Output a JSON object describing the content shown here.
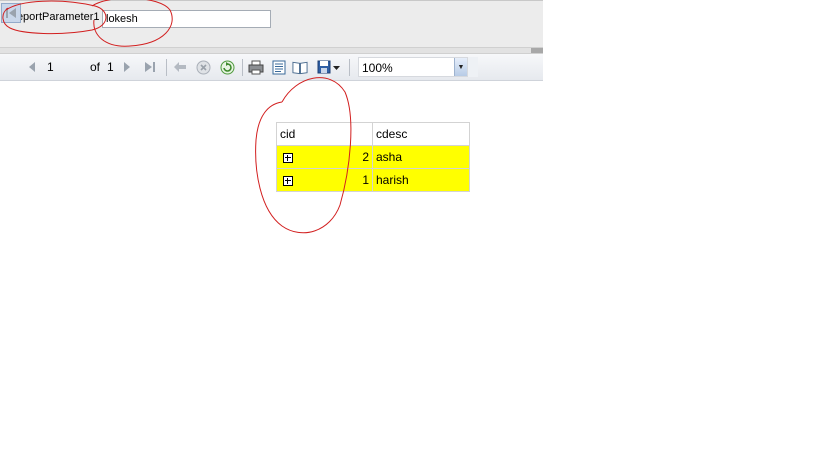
{
  "parameters": {
    "label": "ReportParameter1",
    "value": "lokesh"
  },
  "toolbar": {
    "page_current": "1",
    "page_of": "of",
    "page_total": "1",
    "zoom": "100%",
    "icons": [
      "first-page-icon",
      "prev-page-icon",
      "next-page-icon",
      "last-page-icon",
      "back-icon",
      "stop-icon",
      "refresh-icon",
      "print-icon",
      "print-layout-icon",
      "page-setup-icon",
      "export-icon"
    ]
  },
  "report": {
    "headers": [
      "cid",
      "cdesc"
    ],
    "rows": [
      {
        "cid": "2",
        "cdesc": "asha"
      },
      {
        "cid": "1",
        "cdesc": "harish"
      }
    ],
    "row_color": "#ffff00"
  },
  "annotation_color": "#d21f1f"
}
